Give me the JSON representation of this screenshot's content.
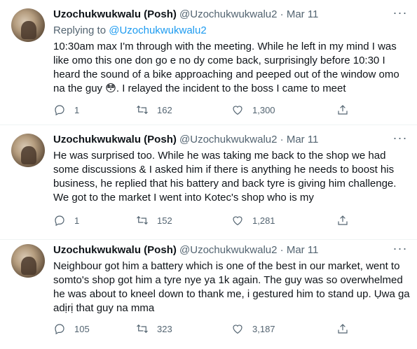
{
  "tweets": [
    {
      "name": "Uzochukwukwalu (Posh)",
      "handle": "@Uzochukwukwalu2",
      "separator": "·",
      "date": "Mar 11",
      "replying_prefix": "Replying to ",
      "replying_to": "@Uzochukwukwalu2",
      "text": "10:30am max I'm through with the meeting. While he left in my mind I was like omo this one don go e no dy come back, surprisingly before 10:30 I heard the sound of a bike approaching and peeped out of the window omo na the guy 😳. I relayed the incident to the boss I came to meet",
      "replies": "1",
      "retweets": "162",
      "likes": "1,300"
    },
    {
      "name": "Uzochukwukwalu (Posh)",
      "handle": "@Uzochukwukwalu2",
      "separator": "·",
      "date": "Mar 11",
      "text": "He was surprised too. While he was taking me back to the shop we had some discussions & I asked him if there is anything he needs to boost his business, he replied that his battery and back tyre is giving him challenge. We got to the market I went into Kotec's shop who is my",
      "replies": "1",
      "retweets": "152",
      "likes": "1,281"
    },
    {
      "name": "Uzochukwukwalu (Posh)",
      "handle": "@Uzochukwukwalu2",
      "separator": "·",
      "date": "Mar 11",
      "text": "Neighbour got him a battery which is one of the best in our market, went to somto's shop got him a tyre nye ya 1k again. The guy was so overwhelmed he was about to kneel down to thank me, i gestured him to stand up. Ụwa ga adịrị that guy na mma",
      "replies": "105",
      "retweets": "323",
      "likes": "3,187"
    }
  ],
  "icons": {
    "more": "more-horizontal-icon",
    "reply": "reply-icon",
    "retweet": "retweet-icon",
    "like": "heart-icon",
    "share": "share-icon"
  },
  "colors": {
    "text": "#0f1419",
    "muted": "#536471",
    "link": "#1d9bf0",
    "divider": "#eff3f4"
  }
}
